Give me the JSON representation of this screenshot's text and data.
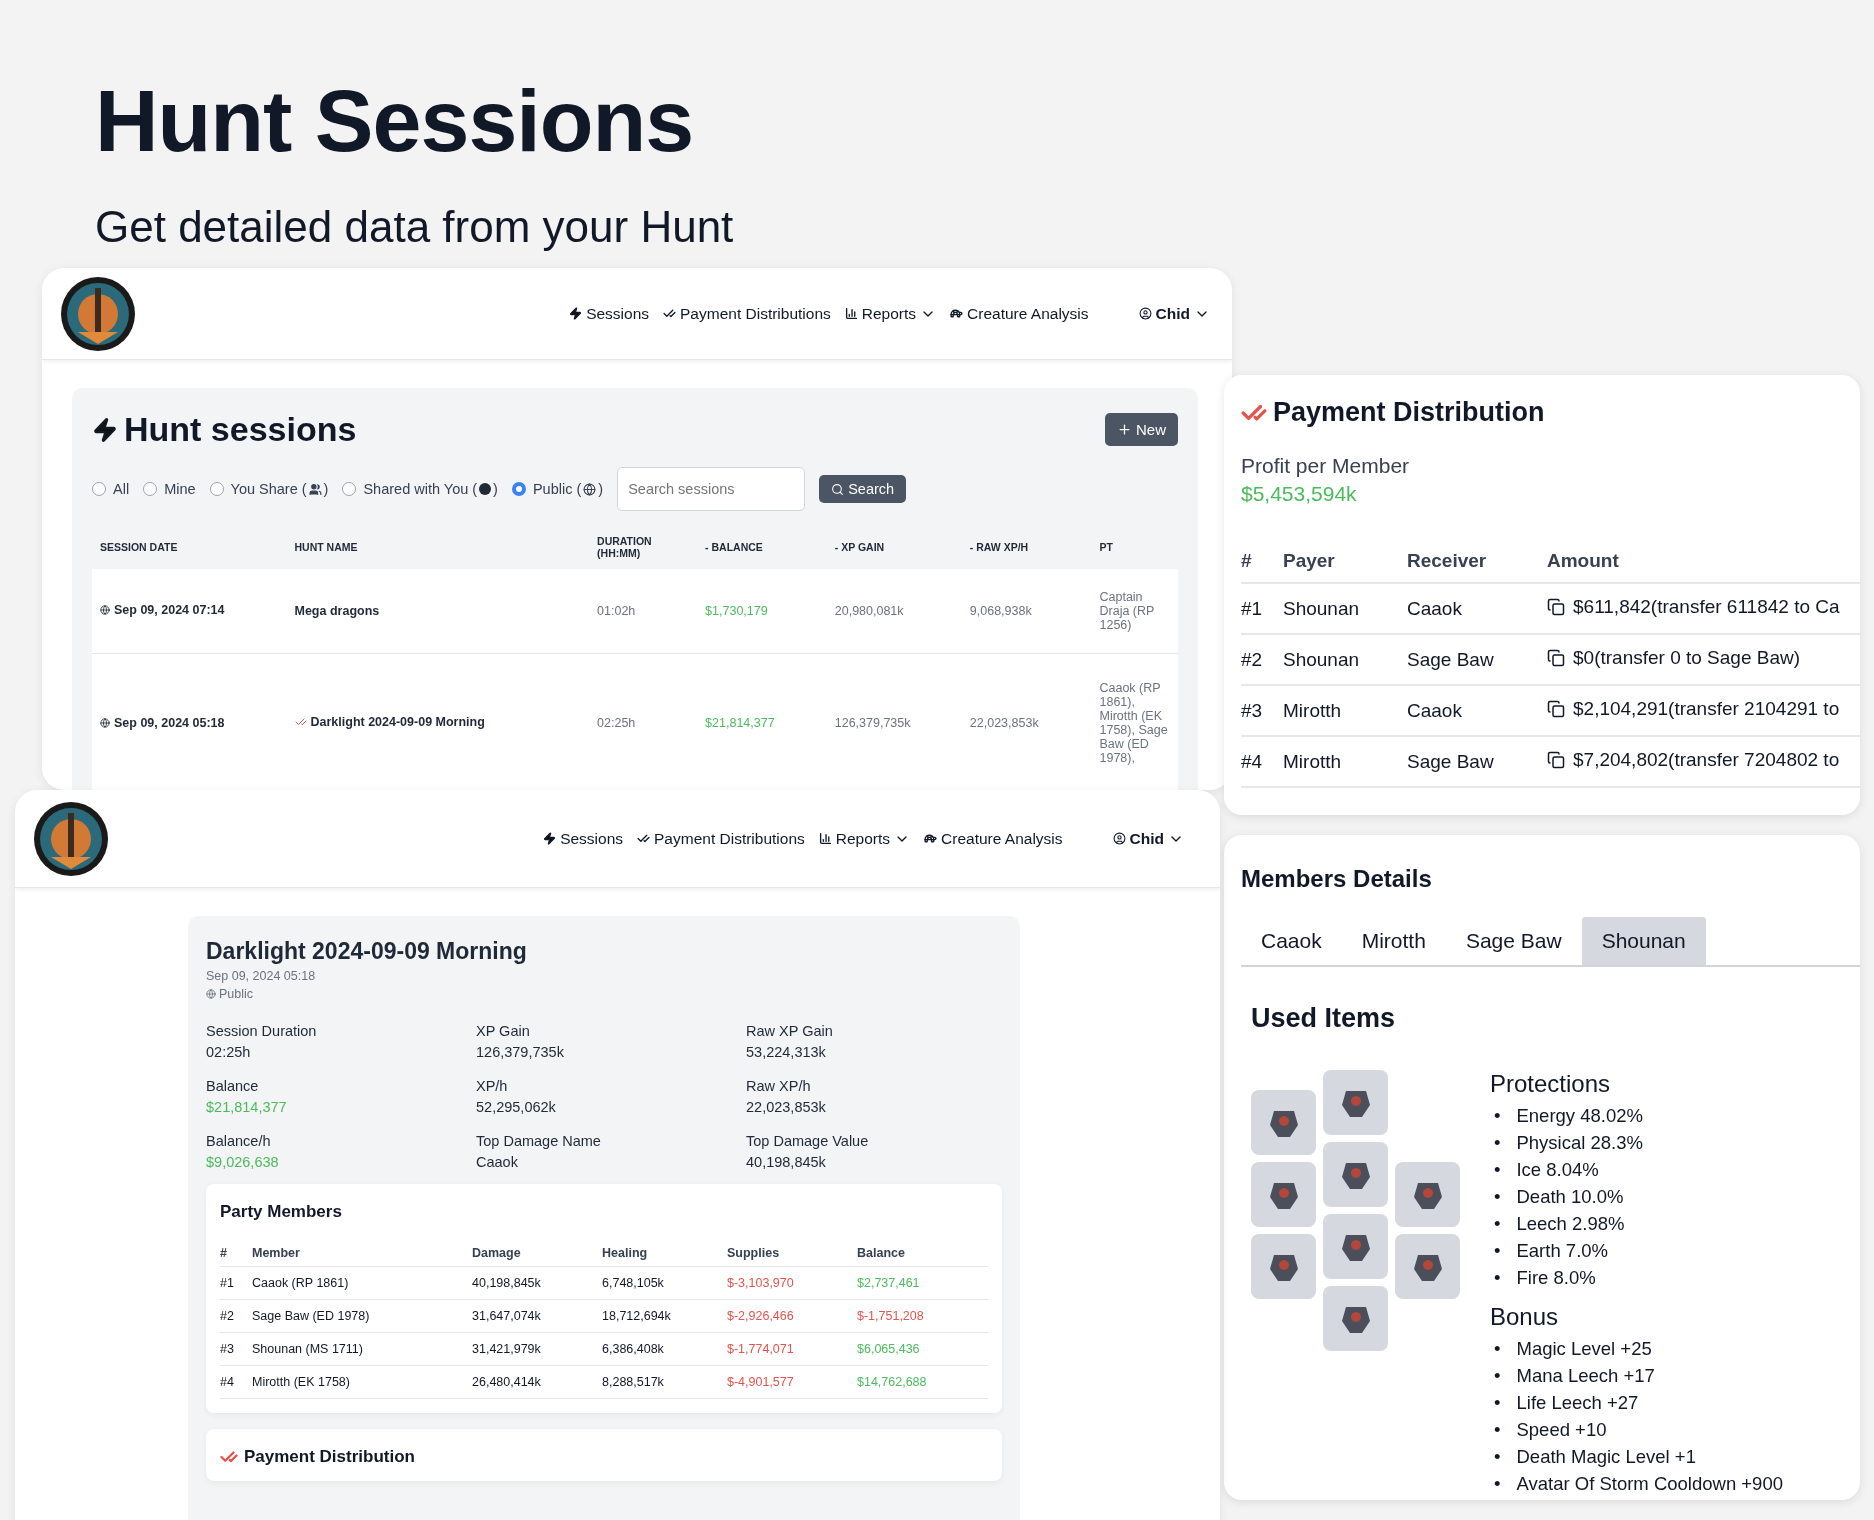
{
  "hero": {
    "title": "Hunt Sessions",
    "subtitle": "Get detailed data from your Hunt"
  },
  "sessions_nav": {
    "links": [
      {
        "label": "Sessions"
      },
      {
        "label": "Payment Distributions"
      },
      {
        "label": "Reports",
        "dropdown": true
      },
      {
        "label": "Creature Analysis"
      }
    ],
    "user": "Chid"
  },
  "sessions": {
    "title": "Hunt sessions",
    "new_button": "New",
    "filters": [
      {
        "label": "All",
        "selected": false
      },
      {
        "label": "Mine",
        "selected": false
      },
      {
        "label": "You Share",
        "selected": false,
        "badge": {
          "open": "(",
          "close": ")"
        }
      },
      {
        "label": "Shared with You",
        "selected": false,
        "badge": {
          "open": "(",
          "close": ")"
        }
      },
      {
        "label": "Public",
        "selected": true,
        "badge": {
          "open": "(",
          "close": ")"
        }
      }
    ],
    "search": {
      "placeholder": "Search sessions",
      "button": "Search"
    },
    "columns": [
      "SESSION DATE",
      "HUNT NAME",
      "DURATION (HH:MM)",
      "- BALANCE",
      "- XP GAIN",
      "- RAW XP/H",
      "PT"
    ],
    "rows": [
      {
        "date": "Sep 09, 2024 07:14",
        "name": "Mega dragons",
        "paid": false,
        "duration": "01:02h",
        "balance": "$1,730,179",
        "xp_gain": "20,980,081k",
        "raw_xph": "9,068,938k",
        "pt": "Captain Draja (RP 1256)"
      },
      {
        "date": "Sep 09, 2024 05:18",
        "name": "Darklight 2024-09-09 Morning",
        "paid": true,
        "duration": "02:25h",
        "balance": "$21,814,377",
        "xp_gain": "126,379,735k",
        "raw_xph": "22,023,853k",
        "pt": "Caaok (RP 1861), Mirotth (EK 1758), Sage Baw (ED 1978),"
      }
    ]
  },
  "detail_nav": {
    "links": [
      {
        "label": "Sessions"
      },
      {
        "label": "Payment Distributions"
      },
      {
        "label": "Reports",
        "dropdown": true
      },
      {
        "label": "Creature Analysis"
      }
    ],
    "user": "Chid"
  },
  "detail": {
    "title": "Darklight 2024-09-09 Morning",
    "date": "Sep 09, 2024 05:18",
    "visibility": "Public",
    "stats": [
      {
        "label": "Session Duration",
        "value": "02:25h",
        "color": "#1f2937"
      },
      {
        "label": "XP Gain",
        "value": "126,379,735k",
        "color": "#1f2937"
      },
      {
        "label": "Raw XP Gain",
        "value": "53,224,313k",
        "color": "#1f2937"
      },
      {
        "label": "Balance",
        "value": "$21,814,377",
        "color": "#4cbb5c"
      },
      {
        "label": "XP/h",
        "value": "52,295,062k",
        "color": "#1f2937"
      },
      {
        "label": "Raw XP/h",
        "value": "22,023,853k",
        "color": "#1f2937"
      },
      {
        "label": "Balance/h",
        "value": "$9,026,638",
        "color": "#4cbb5c"
      },
      {
        "label": "Top Damage Name",
        "value": "Caaok",
        "color": "#1f2937"
      },
      {
        "label": "Top Damage Value",
        "value": "40,198,845k",
        "color": "#1f2937"
      }
    ],
    "party": {
      "title": "Party Members",
      "columns": [
        "#",
        "Member",
        "Damage",
        "Healing",
        "Supplies",
        "Balance"
      ],
      "rows": [
        {
          "rank": "#1",
          "member": "Caaok (RP 1861)",
          "damage": "40,198,845k",
          "healing": "6,748,105k",
          "supplies": {
            "text": "$-3,103,970",
            "color": "#e5534b"
          },
          "balance": {
            "text": "$2,737,461",
            "color": "#4cbb5c"
          }
        },
        {
          "rank": "#2",
          "member": "Sage Baw (ED 1978)",
          "damage": "31,647,074k",
          "healing": "18,712,694k",
          "supplies": {
            "text": "$-2,926,466",
            "color": "#e5534b"
          },
          "balance": {
            "text": "$-1,751,208",
            "color": "#e5534b"
          }
        },
        {
          "rank": "#3",
          "member": "Shounan (MS 1711)",
          "damage": "31,421,979k",
          "healing": "6,386,408k",
          "supplies": {
            "text": "$-1,774,071",
            "color": "#e5534b"
          },
          "balance": {
            "text": "$6,065,436",
            "color": "#4cbb5c"
          }
        },
        {
          "rank": "#4",
          "member": "Mirotth (EK 1758)",
          "damage": "26,480,414k",
          "healing": "8,288,517k",
          "supplies": {
            "text": "$-4,901,577",
            "color": "#e5534b"
          },
          "balance": {
            "text": "$14,762,688",
            "color": "#4cbb5c"
          }
        }
      ]
    },
    "payment_title": "Payment Distribution"
  },
  "payment": {
    "title": "Payment Distribution",
    "profit_label": "Profit per Member",
    "profit_value": "$5,453,594k",
    "columns": [
      "#",
      "Payer",
      "Receiver",
      "Amount"
    ],
    "rows": [
      {
        "rank": "#1",
        "payer": "Shounan",
        "receiver": "Caaok",
        "amount": "$611,842(transfer 611842 to Ca"
      },
      {
        "rank": "#2",
        "payer": "Shounan",
        "receiver": "Sage Baw",
        "amount": "$0(transfer 0 to Sage Baw)"
      },
      {
        "rank": "#3",
        "payer": "Mirotth",
        "receiver": "Caaok",
        "amount": "$2,104,291(transfer 2104291 to"
      },
      {
        "rank": "#4",
        "payer": "Mirotth",
        "receiver": "Sage Baw",
        "amount": "$7,204,802(transfer 7204802 to"
      }
    ]
  },
  "members": {
    "title": "Members Details",
    "tabs": [
      {
        "label": "Caaok",
        "selected": false
      },
      {
        "label": "Mirotth",
        "selected": false
      },
      {
        "label": "Sage Baw",
        "selected": false
      },
      {
        "label": "Shounan",
        "selected": true
      }
    ],
    "used_items_title": "Used Items",
    "protections": {
      "title": "Protections",
      "items": [
        {
          "marker": "•",
          "text": "Energy 48.02%"
        },
        {
          "marker": "•",
          "text": "Physical 28.3%"
        },
        {
          "marker": "•",
          "text": "Ice 8.04%"
        },
        {
          "marker": "•",
          "text": "Death 10.0%"
        },
        {
          "marker": "•",
          "text": "Leech 2.98%"
        },
        {
          "marker": "•",
          "text": "Earth 7.0%"
        },
        {
          "marker": "•",
          "text": "Fire 8.0%"
        }
      ]
    },
    "bonus": {
      "title": "Bonus",
      "items": [
        {
          "marker": "•",
          "text": "Magic Level +25"
        },
        {
          "marker": "•",
          "text": "Mana Leech +17"
        },
        {
          "marker": "•",
          "text": "Life Leech +27"
        },
        {
          "marker": "•",
          "text": "Speed +10"
        },
        {
          "marker": "•",
          "text": "Death Magic Level +1"
        },
        {
          "marker": "•",
          "text": "Avatar Of Storm Cooldown +900"
        }
      ]
    }
  }
}
